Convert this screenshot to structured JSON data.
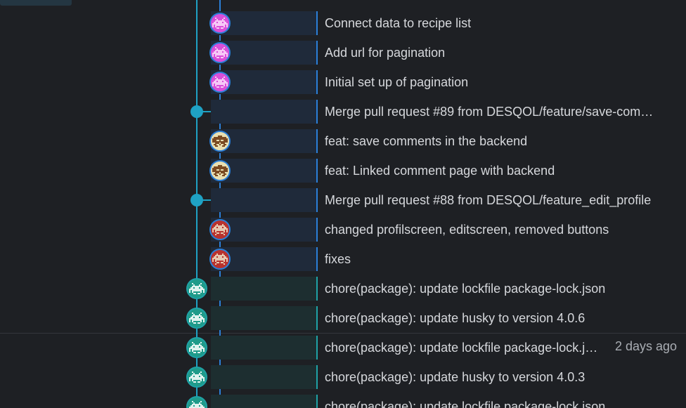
{
  "colors": {
    "background": "#1e2024",
    "branch_main": "#1fa2c4",
    "branch_feature": "#2b7fd8",
    "text": "#d6d8dc"
  },
  "commits": [
    {
      "message": "Connect data to recipe list",
      "branch": "feature",
      "avatar": "pink-invader-avatar",
      "date": ""
    },
    {
      "message": "Add url for pagination",
      "branch": "feature",
      "avatar": "pink-invader-avatar",
      "date": ""
    },
    {
      "message": "Initial set up of pagination",
      "branch": "feature",
      "avatar": "pink-invader-avatar",
      "date": ""
    },
    {
      "message": "Merge pull request #89 from DESQOL/feature/save-com…",
      "branch": "merge",
      "avatar": "merge-dot",
      "date": ""
    },
    {
      "message": "feat: save comments in the backend",
      "branch": "feature",
      "avatar": "brown-invader-avatar",
      "date": ""
    },
    {
      "message": "feat: Linked comment page with backend",
      "branch": "feature",
      "avatar": "brown-invader-avatar",
      "date": ""
    },
    {
      "message": "Merge pull request #88 from DESQOL/feature_edit_profile",
      "branch": "merge",
      "avatar": "merge-dot",
      "date": ""
    },
    {
      "message": "changed profilscreen, editscreen, removed buttons",
      "branch": "feature",
      "avatar": "red-invader-avatar",
      "date": ""
    },
    {
      "message": "fixes",
      "branch": "feature",
      "avatar": "red-invader-avatar",
      "date": ""
    },
    {
      "message": "chore(package): update lockfile package-lock.json",
      "branch": "main",
      "avatar": "green-invader-avatar",
      "date": ""
    },
    {
      "message": "chore(package): update husky to version 4.0.6",
      "branch": "main",
      "avatar": "green-invader-avatar",
      "date": ""
    },
    {
      "message": "chore(package): update lockfile package-lock.j…",
      "branch": "main",
      "avatar": "green-invader-avatar",
      "date": "2 days ago"
    },
    {
      "message": "chore(package): update husky to version 4.0.3",
      "branch": "main",
      "avatar": "green-invader-avatar",
      "date": ""
    },
    {
      "message": "chore(package): update lockfile package-lock.json",
      "branch": "main",
      "avatar": "green-invader-avatar",
      "date": ""
    }
  ]
}
